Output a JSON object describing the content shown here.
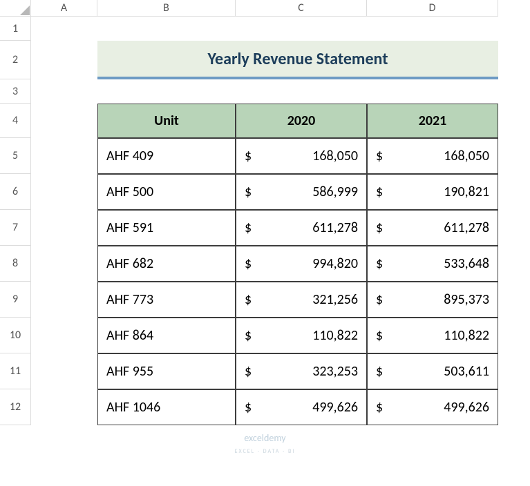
{
  "columns": {
    "A": "A",
    "B": "B",
    "C": "C",
    "D": "D"
  },
  "rows": {
    "1": "1",
    "2": "2",
    "3": "3",
    "4": "4",
    "5": "5",
    "6": "6",
    "7": "7",
    "8": "8",
    "9": "9",
    "10": "10",
    "11": "11",
    "12": "12"
  },
  "title": "Yearly Revenue Statement",
  "headers": {
    "unit": "Unit",
    "y2020": "2020",
    "y2021": "2021"
  },
  "currency": "$",
  "data": [
    {
      "unit": "AHF 409",
      "y2020": "168,050",
      "y2021": "168,050"
    },
    {
      "unit": "AHF 500",
      "y2020": "586,999",
      "y2021": "190,821"
    },
    {
      "unit": "AHF 591",
      "y2020": "611,278",
      "y2021": "611,278"
    },
    {
      "unit": "AHF 682",
      "y2020": "994,820",
      "y2021": "533,648"
    },
    {
      "unit": "AHF 773",
      "y2020": "321,256",
      "y2021": "895,373"
    },
    {
      "unit": "AHF 864",
      "y2020": "110,822",
      "y2021": "110,822"
    },
    {
      "unit": "AHF 955",
      "y2020": "323,253",
      "y2021": "503,611"
    },
    {
      "unit": "AHF 1046",
      "y2020": "499,626",
      "y2021": "499,626"
    }
  ],
  "watermark": {
    "brand": "exceldemy",
    "tagline": "EXCEL · DATA · BI"
  }
}
